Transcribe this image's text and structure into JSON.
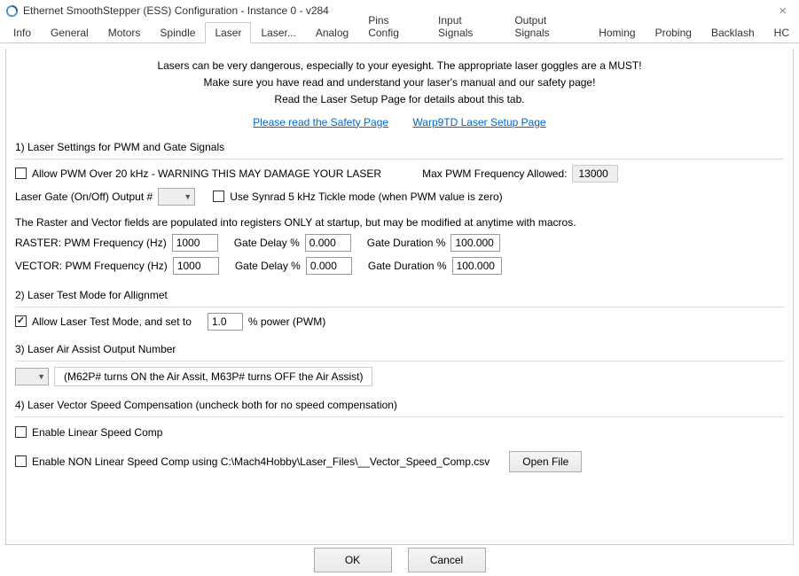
{
  "window": {
    "title": "Ethernet SmoothStepper (ESS) Configuration - Instance 0 - v284"
  },
  "tabs": {
    "items": [
      "Info",
      "General",
      "Motors",
      "Spindle",
      "Laser",
      "Laser...",
      "Analog",
      "Pins Config",
      "Input Signals",
      "Output Signals",
      "Homing",
      "Probing",
      "Backlash",
      "HC"
    ],
    "active_index": 4
  },
  "warnings": {
    "line1": "Lasers can be very dangerous, especially to your eyesight. The appropriate laser goggles are a MUST!",
    "line2": "Make sure you have read and understand your laser's manual and our safety page!",
    "line3": "Read the Laser Setup Page for details about this tab."
  },
  "links": {
    "safety": "Please read the Safety Page",
    "setup": "Warp9TD Laser Setup Page"
  },
  "section1": {
    "title": "1) Laser Settings for PWM and Gate Signals",
    "allow_pwm_over_20khz": {
      "checked": false,
      "label": "Allow PWM Over 20 kHz - WARNING THIS MAY DAMAGE YOUR LASER"
    },
    "max_pwm_label": "Max PWM Frequency Allowed:",
    "max_pwm_value": "13000",
    "gate_output_label": "Laser Gate (On/Off) Output #",
    "gate_output_value": "",
    "synrad": {
      "checked": false,
      "label": "Use Synrad 5 kHz Tickle mode (when PWM value is zero)"
    },
    "note": "The Raster and Vector fields are populated into registers ONLY at startup, but  may be modified at anytime with macros.",
    "raster": {
      "label": "RASTER:  PWM Frequency (Hz)",
      "freq": "1000",
      "gate_delay_label": "Gate Delay %",
      "gate_delay": "0.000",
      "gate_duration_label": "Gate Duration %",
      "gate_duration": "100.000"
    },
    "vector": {
      "label": "VECTOR:  PWM Frequency (Hz)",
      "freq": "1000",
      "gate_delay_label": "Gate Delay %",
      "gate_delay": "0.000",
      "gate_duration_label": "Gate Duration %",
      "gate_duration": "100.000"
    }
  },
  "section2": {
    "title": "2) Laser Test Mode for Allignmet",
    "allow_test": {
      "checked": true,
      "label": "Allow Laser Test Mode, and set to",
      "value": "1.0",
      "suffix": "% power (PWM)"
    }
  },
  "section3": {
    "title": "3) Laser Air Assist Output Number",
    "combo_value": "",
    "hint": "(M62P# turns ON the Air Assit, M63P# turns OFF the Air Assist)"
  },
  "section4": {
    "title": "4) Laser Vector Speed Compensation (uncheck both for no speed compensation)",
    "linear": {
      "checked": false,
      "label": "Enable Linear Speed Comp"
    },
    "nonlinear": {
      "checked": false,
      "label": "Enable NON Linear Speed Comp using C:\\Mach4Hobby\\Laser_Files\\__Vector_Speed_Comp.csv",
      "open_btn": "Open File"
    }
  },
  "buttons": {
    "ok": "OK",
    "cancel": "Cancel"
  }
}
